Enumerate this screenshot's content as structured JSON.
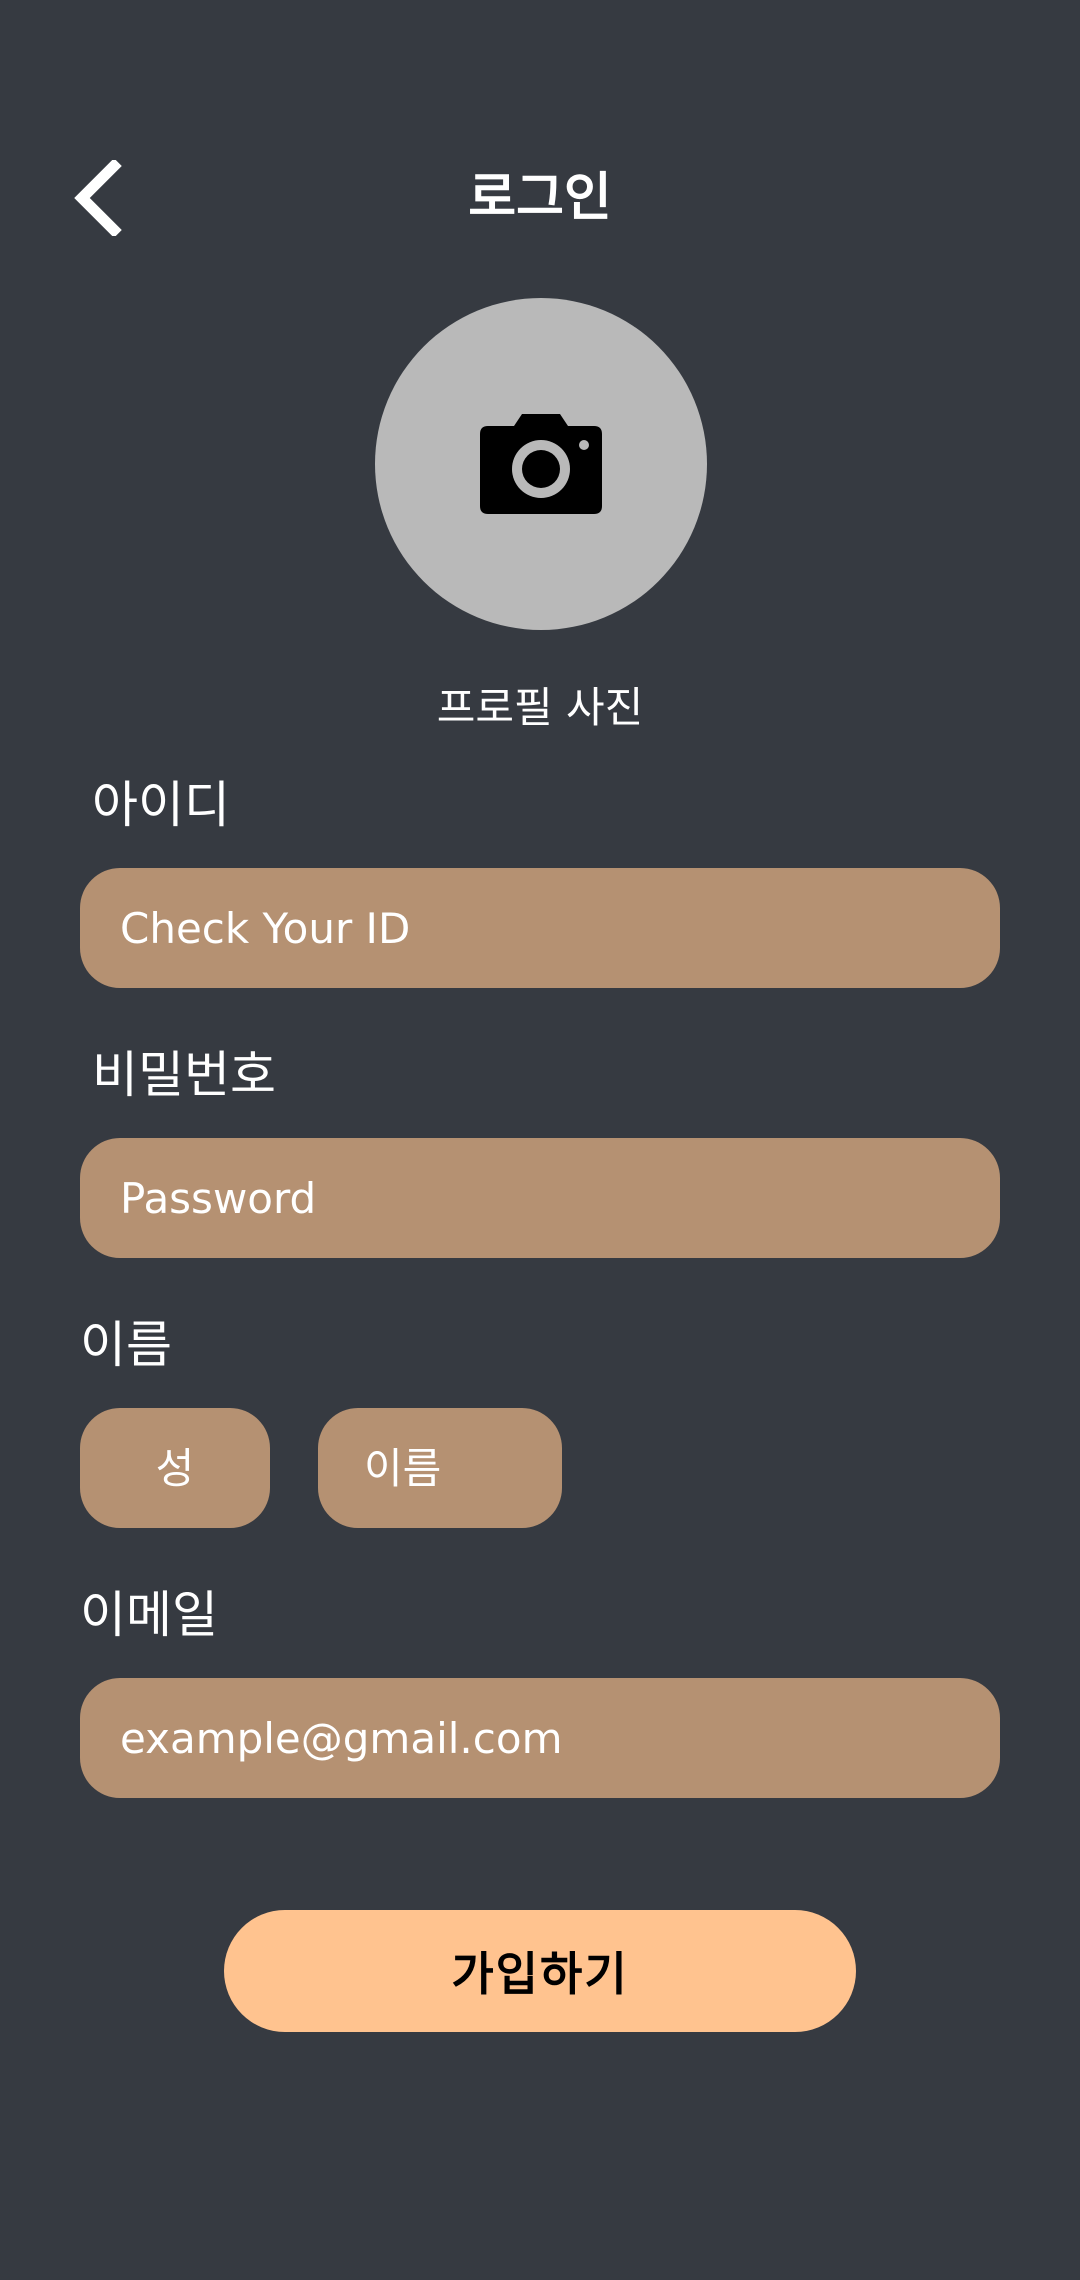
{
  "header": {
    "back_icon": "chevron-left-icon",
    "title": "로그인"
  },
  "profile": {
    "icon": "camera-icon",
    "caption": "프로필 사진",
    "avatar_bg": "#b9b9b9"
  },
  "form": {
    "id": {
      "label": "아이디",
      "placeholder": "Check Your ID"
    },
    "password": {
      "label": "비밀번호",
      "placeholder": "Password"
    },
    "name": {
      "label": "이름",
      "last_placeholder": "성",
      "first_placeholder": "이름"
    },
    "email": {
      "label": "이메일",
      "placeholder": "example@gmail.com"
    }
  },
  "submit": {
    "label": "가입하기"
  },
  "colors": {
    "background": "#363a41",
    "field": "#b59172",
    "accent": "#ffc38f",
    "text": "#ffffff"
  }
}
